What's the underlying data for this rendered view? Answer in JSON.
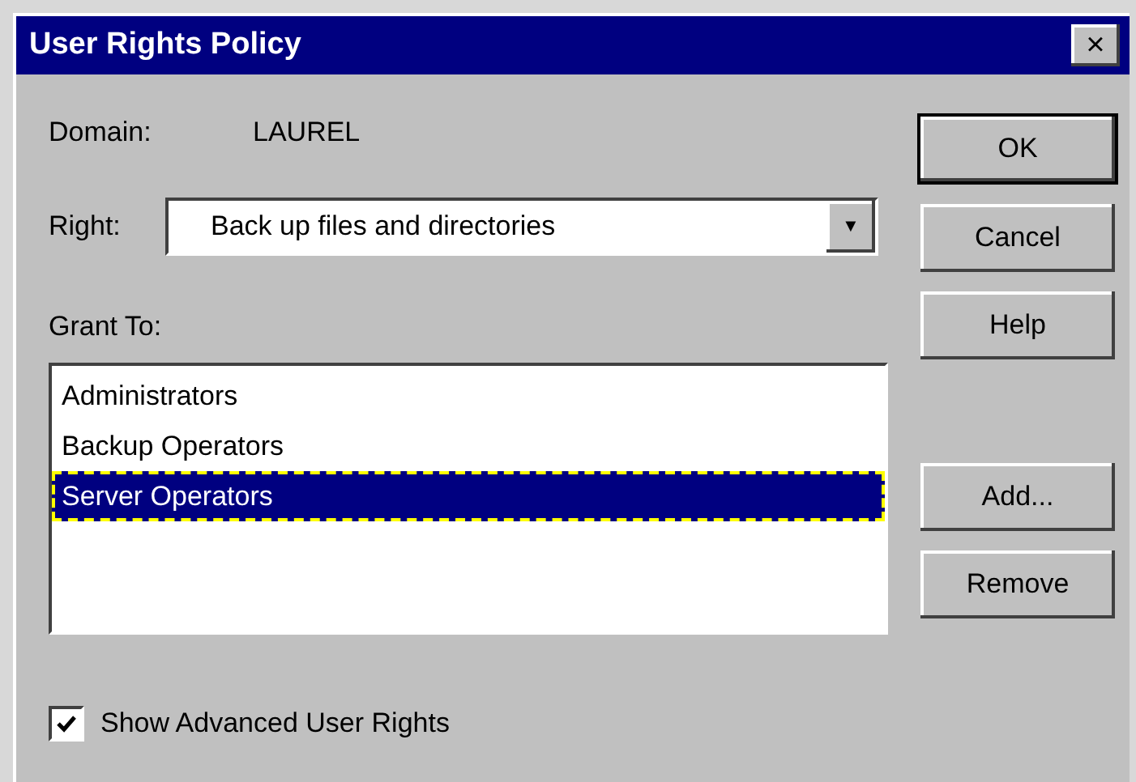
{
  "window": {
    "title": "User Rights Policy",
    "close": "×"
  },
  "domain": {
    "label": "Domain:",
    "value": "LAUREL"
  },
  "right": {
    "label": "Right:",
    "value": "Back up files and directories",
    "arrow": "▼"
  },
  "grant_to": {
    "label": "Grant To:",
    "items": [
      {
        "name": "Administrators",
        "selected": false
      },
      {
        "name": "Backup Operators",
        "selected": false
      },
      {
        "name": "Server Operators",
        "selected": true
      }
    ]
  },
  "buttons": [
    {
      "label": "OK",
      "kind": "default"
    },
    {
      "label": "Cancel",
      "kind": "normal"
    },
    {
      "label": "Help",
      "kind": "normal"
    },
    {
      "label": "Add...",
      "kind": "spaced"
    },
    {
      "label": "Remove",
      "kind": "normal"
    }
  ],
  "show_advanced": {
    "label": "Show Advanced User Rights",
    "checked": true
  }
}
